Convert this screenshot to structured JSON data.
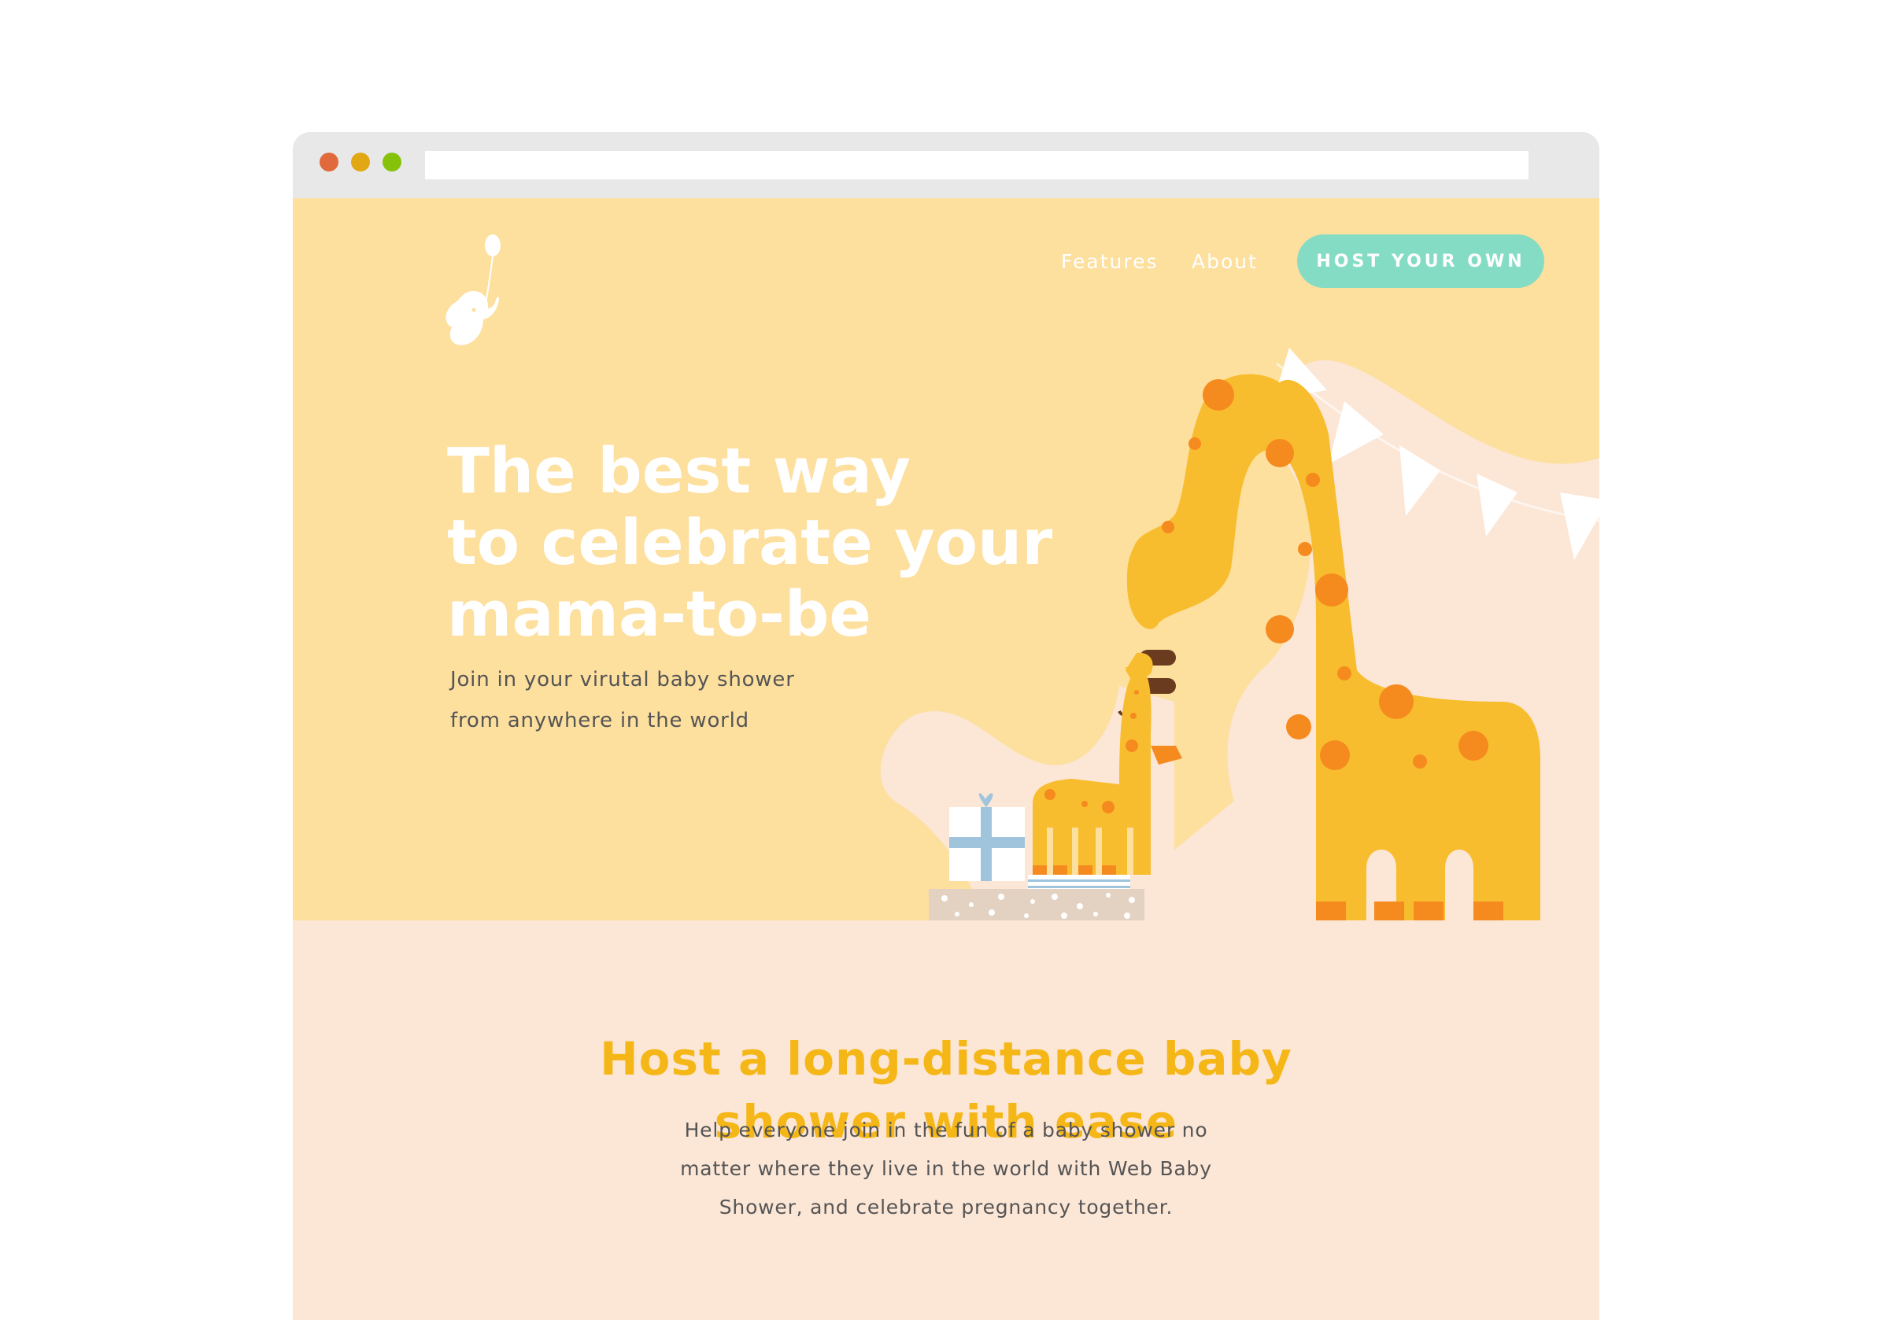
{
  "window": {
    "controls": [
      "close",
      "minimize",
      "maximize"
    ],
    "address": ""
  },
  "nav": {
    "logo_icon": "elephant-balloon-icon",
    "links": [
      {
        "label": "Features"
      },
      {
        "label": "About"
      }
    ],
    "cta_label": "HOST YOUR OWN"
  },
  "hero": {
    "title_lines": [
      "The best way",
      "to celebrate your",
      "mama-to-be"
    ],
    "subtitle_lines": [
      "Join in your virutal baby shower",
      "from anywhere in the world"
    ]
  },
  "features": {
    "title_lines": [
      "Host a long-distance baby",
      "shower with ease"
    ],
    "text_lines": [
      "Help everyone join in the fun of a baby shower no",
      "matter where they live in the world with Web Baby",
      "Shower, and celebrate pregnancy together."
    ]
  },
  "colors": {
    "hero_background": "#fddf9e",
    "section_background": "#fce6d6",
    "accent_button": "#85dcc5",
    "heading_yellow": "#f5b718",
    "giraffe": "#f8bd2e",
    "giraffe_spots": "#f58a1f"
  }
}
